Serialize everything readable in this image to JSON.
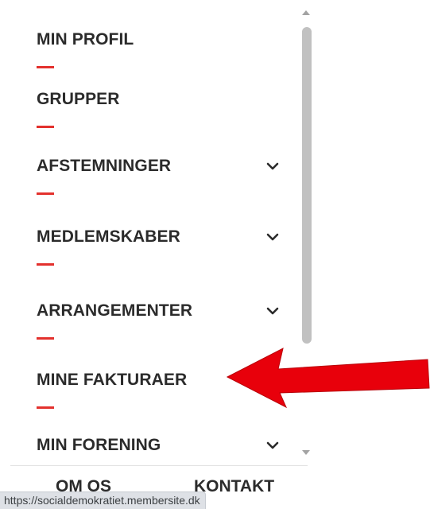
{
  "menu": {
    "items": [
      {
        "label": "MIN PROFIL",
        "has_dropdown": false
      },
      {
        "label": "GRUPPER",
        "has_dropdown": false
      },
      {
        "label": "AFSTEMNINGER",
        "has_dropdown": true
      },
      {
        "label": "MEDLEMSKABER",
        "has_dropdown": true
      },
      {
        "label": "ARRANGEMENTER",
        "has_dropdown": true
      },
      {
        "label": "MINE FAKTURAER",
        "has_dropdown": false
      },
      {
        "label": "MIN FORENING",
        "has_dropdown": true
      }
    ]
  },
  "footer": {
    "links": [
      {
        "label": "OM OS"
      },
      {
        "label": "KONTAKT"
      }
    ]
  },
  "status_bar": {
    "url": "https://socialdemokratiet.membersite.dk"
  },
  "annotation": {
    "arrow_color": "#e8000b",
    "points_to": "MINE FAKTURAER"
  },
  "colors": {
    "accent": "#e3312d",
    "text": "#2b2b2b",
    "scroll_thumb": "#c1c1c1"
  },
  "icons": {
    "dropdown": "chevron-down-icon",
    "scroll_up": "scroll-up-arrow-icon",
    "scroll_down": "scroll-down-arrow-icon",
    "annotation": "red-arrow-icon"
  }
}
